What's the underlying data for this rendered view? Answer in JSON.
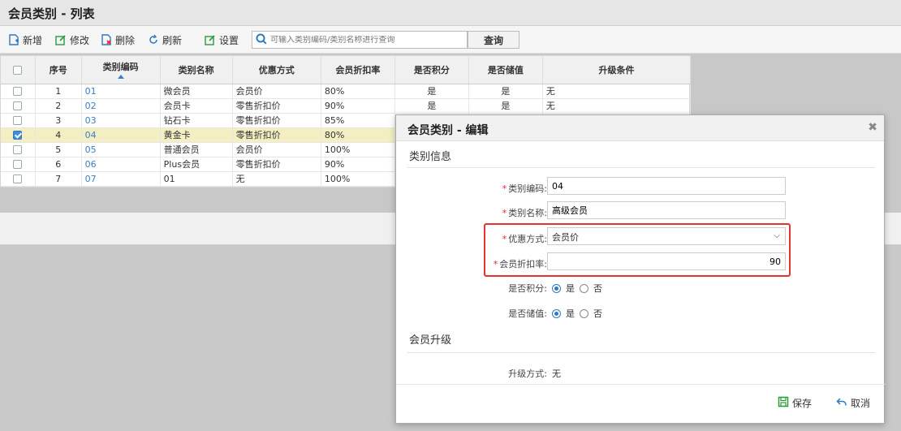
{
  "title": "会员类别 - 列表",
  "toolbar": {
    "add": "新增",
    "edit": "修改",
    "delete": "删除",
    "refresh": "刷新",
    "settings": "设置",
    "search_placeholder": "可输入类别编码/类别名称进行查询",
    "query": "查询"
  },
  "table": {
    "headers": [
      "序号",
      "类别编码",
      "类别名称",
      "优惠方式",
      "会员折扣率",
      "是否积分",
      "是否储值",
      "升级条件"
    ],
    "rows": [
      {
        "no": "1",
        "code": "01",
        "name": "微会员",
        "mode": "会员价",
        "rate": "80%",
        "points": "是",
        "stored": "是",
        "upgrade": "无",
        "checked": false
      },
      {
        "no": "2",
        "code": "02",
        "name": "会员卡",
        "mode": "零售折扣价",
        "rate": "90%",
        "points": "是",
        "stored": "是",
        "upgrade": "无",
        "checked": false
      },
      {
        "no": "3",
        "code": "03",
        "name": "钻石卡",
        "mode": "零售折扣价",
        "rate": "85%",
        "points": "",
        "stored": "",
        "upgrade": "",
        "checked": false
      },
      {
        "no": "4",
        "code": "04",
        "name": "黄金卡",
        "mode": "零售折扣价",
        "rate": "80%",
        "points": "",
        "stored": "",
        "upgrade": "",
        "checked": true
      },
      {
        "no": "5",
        "code": "05",
        "name": "普通会员",
        "mode": "会员价",
        "rate": "100%",
        "points": "",
        "stored": "",
        "upgrade": "",
        "checked": false
      },
      {
        "no": "6",
        "code": "06",
        "name": "Plus会员",
        "mode": "零售折扣价",
        "rate": "90%",
        "points": "",
        "stored": "",
        "upgrade": "",
        "checked": false
      },
      {
        "no": "7",
        "code": "07",
        "name": "01",
        "mode": "无",
        "rate": "100%",
        "points": "",
        "stored": "",
        "upgrade": "",
        "checked": false
      }
    ]
  },
  "dialog": {
    "title": "会员类别 - 编辑",
    "section_info": "类别信息",
    "code_label": "类别编码:",
    "code_value": "04",
    "name_label": "类别名称:",
    "name_value": "高级会员",
    "mode_label": "优惠方式:",
    "mode_value": "会员价",
    "rate_label": "会员折扣率:",
    "rate_value": "90",
    "points_label": "是否积分:",
    "stored_label": "是否储值:",
    "yes": "是",
    "no": "否",
    "section_upgrade": "会员升级",
    "upgrade_label": "升级方式:",
    "upgrade_value": "无",
    "save": "保存",
    "cancel": "取消"
  },
  "colors": {
    "accent": "#3a7ec6",
    "highlight": "#e8322e",
    "selected_row": "#f3efc2"
  }
}
